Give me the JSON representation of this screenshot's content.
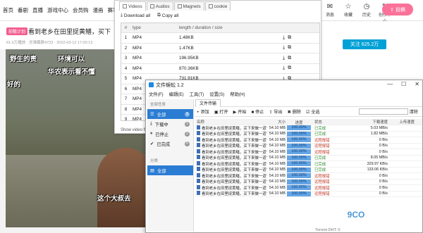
{
  "bg_nav": {
    "links": [
      "首页",
      "番剧",
      "直播",
      "游戏中心",
      "会员购",
      "漫画",
      "赛事"
    ],
    "right_icons": [
      {
        "glyph": "✉",
        "label": "消息"
      },
      {
        "glyph": "☆",
        "label": "收藏"
      },
      {
        "glyph": "◷",
        "label": "历史"
      },
      {
        "glyph": "✎",
        "label": "创作中心"
      }
    ],
    "login_label": "投稿"
  },
  "video": {
    "tag": "前瞻计划",
    "title": "看到老乡在田里捉黄鳝，买下",
    "meta": "61.6万播放 · 总弹幕数4723 · 2022-03-12 17:00:13",
    "subtitles": [
      "野生的责",
      "环境可以",
      "华农表示看不懂",
      "好的",
      "这个大叔去"
    ]
  },
  "bili_right": {
    "follow_label": "关注 625.2万"
  },
  "extension": {
    "tabs": [
      "Videos",
      "Audios",
      "Magnets",
      "cookie"
    ],
    "buttons": [
      "Download all",
      "Copy all"
    ],
    "columns": [
      "#",
      "type",
      "length / duration / size"
    ],
    "rows": [
      {
        "n": "1",
        "type": "MP4",
        "size": "1.48KB"
      },
      {
        "n": "2",
        "type": "MP4",
        "size": "1.47KB"
      },
      {
        "n": "3",
        "type": "MP4",
        "size": "196.95KB"
      },
      {
        "n": "4",
        "type": "MP4",
        "size": "870.36KB"
      },
      {
        "n": "5",
        "type": "MP4",
        "size": "731.91KB"
      },
      {
        "n": "6",
        "type": "MP4",
        "size": ""
      },
      {
        "n": "7",
        "type": "MP4",
        "size": ""
      },
      {
        "n": "8",
        "type": "MP4",
        "size": ""
      },
      {
        "n": "9",
        "type": "MP4",
        "size": ""
      }
    ],
    "footer": "Show video floatin"
  },
  "file_manager": {
    "title": "文件蜈蚣 1.2",
    "menu": [
      "文件(F)",
      "编辑(E)",
      "工具(T)",
      "设置(S)",
      "帮助(H)"
    ],
    "side_header": "全部任务",
    "side_items": [
      {
        "label": "全部",
        "count": "9"
      },
      {
        "label": "下载中",
        "count": "1"
      },
      {
        "label": "已停止",
        "count": "2"
      },
      {
        "label": "已完成",
        "count": "6"
      }
    ],
    "side_header2": "分类",
    "side_items2": [
      {
        "label": "全部"
      }
    ],
    "tab": "文件传输",
    "toolbar": [
      "添加",
      "打开",
      "开始",
      "停止",
      "导出",
      "删除",
      "全选"
    ],
    "search_label": "清除",
    "columns": [
      "名称",
      "大小",
      "进度",
      "状态",
      "下载速度",
      "上传速度"
    ],
    "rows": [
      {
        "name": "看到老乡在田里捉黄鳝，买下来做一道'鲜...",
        "size": "54.10 MB",
        "progress": 100,
        "status": "已完成",
        "status_type": "ok",
        "speed": "5.03 MB/s"
      },
      {
        "name": "看到老乡在田里捉黄鳝，买下来做一道'鲜...",
        "size": "54.10 MB",
        "progress": 100,
        "status": "已完成",
        "status_type": "ok",
        "speed": "1.82 MB/s"
      },
      {
        "name": "看到老乡在田里捉黄鳝，买下来做一道'鲜...",
        "size": "54.10 MB",
        "progress": 100,
        "status": "远程报错",
        "status_type": "err",
        "speed": "0 B/s"
      },
      {
        "name": "看到老乡在田里捉黄鳝，买下来做一道'鲜...",
        "size": "54.10 MB",
        "progress": 100,
        "status": "远程报错",
        "status_type": "err",
        "speed": "0 B/s"
      },
      {
        "name": "看到老乡在田里捉黄鳝，买下来做一道'鲜...",
        "size": "54.10 MB",
        "progress": 100,
        "status": "远程报错",
        "status_type": "err",
        "speed": "0 B/s"
      },
      {
        "name": "看到老乡在田里捉黄鳝，买下来做一道'鲜...",
        "size": "54.10 MB",
        "progress": 100,
        "status": "已完成",
        "status_type": "ok",
        "speed": "8.05 MB/s"
      },
      {
        "name": "看到老乡在田里捉黄鳝，买下来做一道'鲜...",
        "size": "54.10 MB",
        "progress": 100,
        "status": "已完成",
        "status_type": "ok",
        "speed": "329.97 KB/s"
      },
      {
        "name": "看到老乡在田里捉黄鳝，买下来做一道'鲜...",
        "size": "54.10 MB",
        "progress": 100,
        "status": "已完成",
        "status_type": "ok",
        "speed": "133.06 KB/s"
      },
      {
        "name": "看到老乡在田里捉黄鳝，买下来做一道'鲜...",
        "size": "54.10 MB",
        "progress": 100,
        "status": "远程报错",
        "status_type": "err",
        "speed": "0 B/s"
      },
      {
        "name": "看到老乡在田里捉黄鳝，买下来做一道'鲜...",
        "size": "54.10 MB",
        "progress": 100,
        "status": "远程报错",
        "status_type": "err",
        "speed": "0 B/s"
      },
      {
        "name": "看到老乡在田里捉黄鳝，买下来做一道'鲜...",
        "size": "54.10 MB",
        "progress": 100,
        "status": "远程报错",
        "status_type": "err",
        "speed": "0 B/s"
      },
      {
        "name": "看到老乡在田里捉黄鳝，买下来做一道'鲜...",
        "size": "54.10 MB",
        "progress": 100,
        "status": "远程报错",
        "status_type": "err",
        "speed": "0 B/s"
      }
    ],
    "status_text": "Torrent DHT: 0"
  },
  "watermark": "9CO"
}
